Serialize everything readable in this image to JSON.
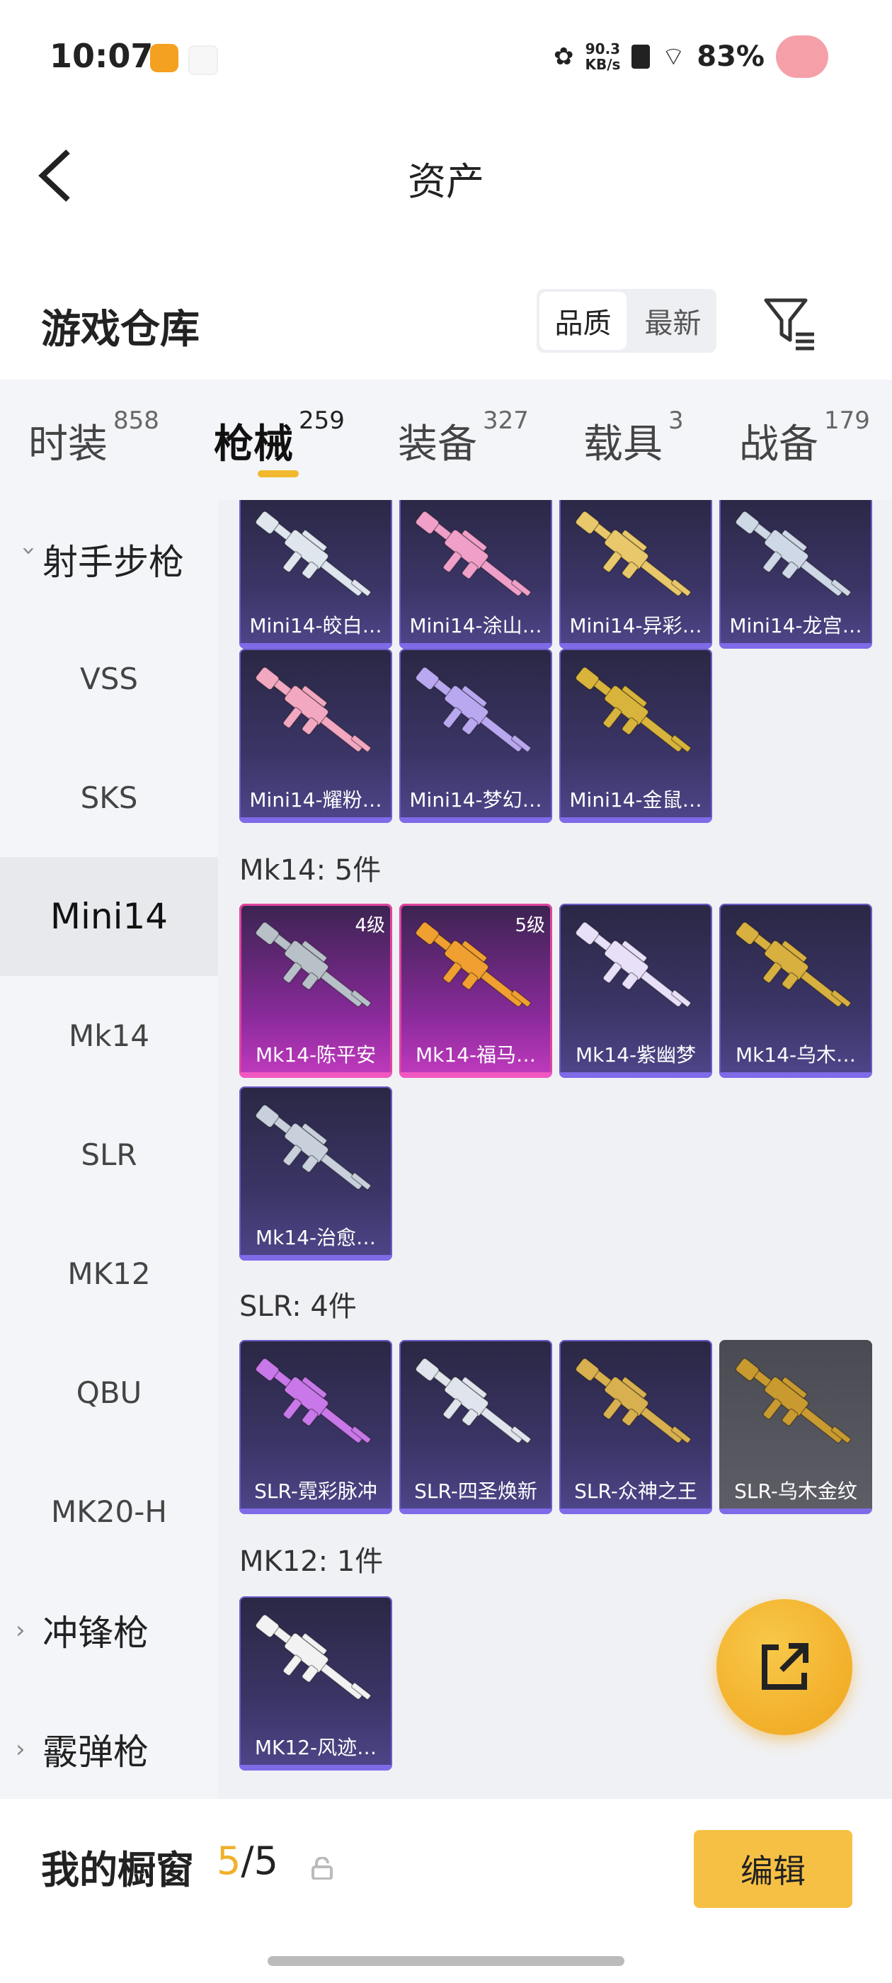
{
  "status_bar": {
    "time": "10:07",
    "net_speed_value": "90.3",
    "net_speed_unit": "KB/s",
    "battery": "83%"
  },
  "header": {
    "title": "资产"
  },
  "warehouse": {
    "title": "游戏仓库",
    "sort_options": [
      "品质",
      "最新"
    ],
    "active_sort": "品质"
  },
  "tabs": [
    {
      "label": "时装",
      "count": "858"
    },
    {
      "label": "枪械",
      "count": "259",
      "active": true
    },
    {
      "label": "装备",
      "count": "327"
    },
    {
      "label": "载具",
      "count": "3"
    },
    {
      "label": "战备",
      "count": "179"
    }
  ],
  "sidebar": {
    "group_open": "射手步枪",
    "items": [
      "VSS",
      "SKS",
      "Mini14",
      "Mk14",
      "SLR",
      "MK12",
      "QBU",
      "MK20-H"
    ],
    "active_item": "Mini14",
    "collapsed_groups": [
      "冲锋枪",
      "霰弹枪"
    ]
  },
  "sections": {
    "mini14": {
      "items": [
        {
          "name": "Mini14-皎白…",
          "color": "#dfe6ee"
        },
        {
          "name": "Mini14-涂山…",
          "color": "#f0a0c8"
        },
        {
          "name": "Mini14-异彩…",
          "color": "#e8c86a"
        },
        {
          "name": "Mini14-龙宫…",
          "color": "#cfd8e6"
        },
        {
          "name": "Mini14-耀粉…",
          "color": "#f2a8c0"
        },
        {
          "name": "Mini14-梦幻…",
          "color": "#b9a8f0"
        },
        {
          "name": "Mini14-金鼠…",
          "color": "#d8b43c"
        }
      ]
    },
    "mk14": {
      "title": "Mk14: 5件",
      "items": [
        {
          "name": "Mk14-陈平安",
          "level": "4级",
          "tier": "pink",
          "color": "#b8c0c8"
        },
        {
          "name": "Mk14-福马…",
          "level": "5级",
          "tier": "pink",
          "color": "#f0a030"
        },
        {
          "name": "Mk14-紫幽梦",
          "color": "#e8e0f8"
        },
        {
          "name": "Mk14-乌木…",
          "color": "#d8b040"
        },
        {
          "name": "Mk14-治愈…",
          "color": "#c8d0dc"
        }
      ]
    },
    "slr": {
      "title": "SLR: 4件",
      "items": [
        {
          "name": "SLR-霓彩脉冲",
          "color": "#c878e8"
        },
        {
          "name": "SLR-四圣焕新",
          "color": "#e0e4ec"
        },
        {
          "name": "SLR-众神之王",
          "color": "#d8b050"
        },
        {
          "name": "SLR-乌木金纹",
          "tier": "gray",
          "color": "#c89a30"
        }
      ]
    },
    "mk12": {
      "title": "MK12: 1件",
      "items": [
        {
          "name": "MK12-风迹…",
          "color": "#f2f2f2"
        }
      ]
    }
  },
  "showcase": {
    "label": "我的橱窗",
    "current": "5",
    "separator": "/",
    "total": "5",
    "edit_label": "编辑"
  }
}
